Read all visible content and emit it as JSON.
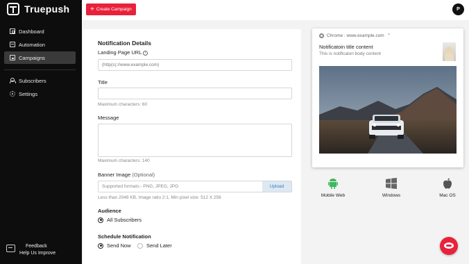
{
  "app": {
    "name": "Truepush"
  },
  "sidebar": {
    "items": [
      {
        "label": "Dashboard",
        "icon": "dashboard-icon"
      },
      {
        "label": "Automation",
        "icon": "automation-icon"
      },
      {
        "label": "Campaigns",
        "icon": "campaigns-icon",
        "active": true
      },
      {
        "label": "Subscribers",
        "icon": "subscribers-icon"
      },
      {
        "label": "Settings",
        "icon": "settings-icon"
      }
    ],
    "feedback": {
      "line1": "Feedback",
      "line2": "Help Us Improve"
    }
  },
  "topbar": {
    "create_label": "Create Campaign",
    "avatar_initial": "P"
  },
  "form": {
    "title": "Notification Details",
    "landing_label": "Landing Page URL",
    "landing_placeholder": "(http(s)://www.example.com)",
    "title_label": "Title",
    "title_hint": "Maximum characters: 60",
    "message_label": "Message",
    "message_hint": "Maximum characters: 140",
    "banner_label": "Banner Image",
    "banner_optional": "(Optional)",
    "banner_placeholder": "Supported formats:- PNG, JPEG, JPG",
    "upload_label": "Upload",
    "banner_hint": "Less than 2048 KB, Image ratio 2:1, Min pixel size: 512 X 256",
    "audience_label": "Audience",
    "audience_option": "All Subscribers",
    "schedule_label": "Schedule Notification",
    "send_now": "Send Now",
    "send_later": "Send Later"
  },
  "preview": {
    "browser_line": "Chrome : www.example.com",
    "notif_title": "Notificatoin title content",
    "notif_body": "This is notificaion body content"
  },
  "platforms": [
    {
      "label": "Mobile Web",
      "icon": "android-icon"
    },
    {
      "label": "Windows",
      "icon": "windows-icon"
    },
    {
      "label": "Mac OS",
      "icon": "apple-icon"
    }
  ],
  "colors": {
    "accent": "#e8223b",
    "sidebar_bg": "#0d0d0d",
    "upload_text": "#3b7cc4"
  }
}
